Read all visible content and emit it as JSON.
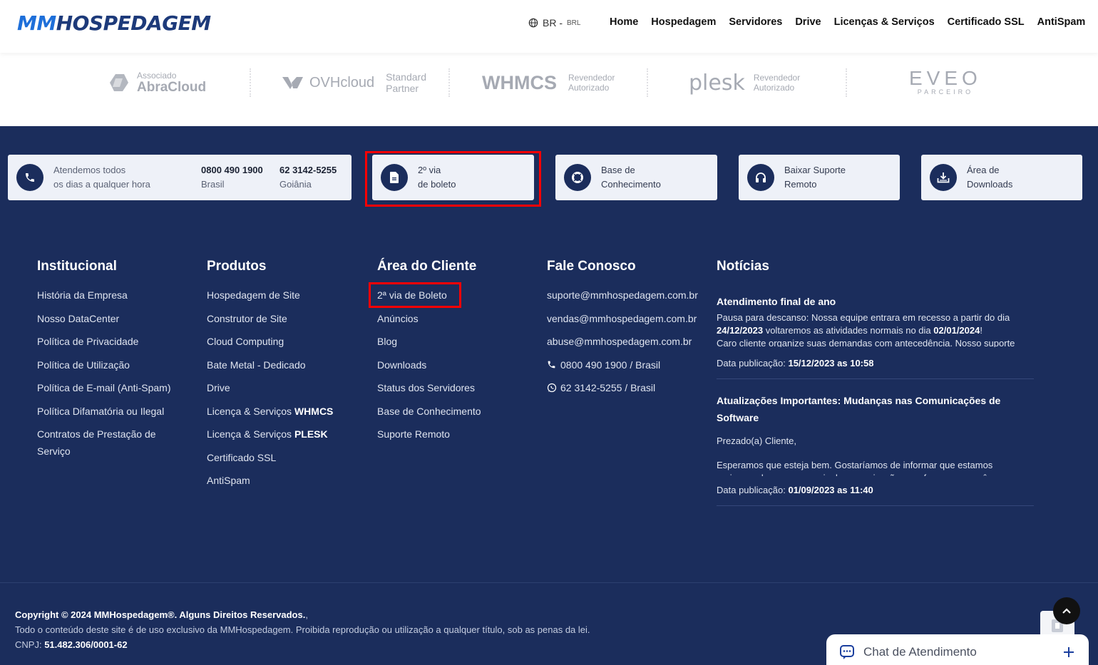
{
  "header": {
    "logo_mm": "MM",
    "logo_rest": "HOSPEDAGEM",
    "lang_main": "BR -",
    "lang_currency": "BRL",
    "nav": [
      "Home",
      "Hospedagem",
      "Servidores",
      "Drive",
      "Licenças & Serviços",
      "Certificado SSL",
      "AntiSpam"
    ]
  },
  "partners": {
    "abracloud_top": "Associado",
    "abracloud_name": "AbraCloud",
    "ovh_name": "OVHcloud",
    "ovh_tier_1": "Standard",
    "ovh_tier_2": "Partner",
    "whmcs_name": "WHMCS",
    "whmcs_sub_1": "Revendedor",
    "whmcs_sub_2": "Autorizado",
    "plesk_name": "plesk",
    "plesk_sub_1": "Revendedor",
    "plesk_sub_2": "Autorizado",
    "eveo_name": "EVEO",
    "eveo_sub": "PARCEIRO"
  },
  "cards": {
    "support_line1": "Atendemos todos",
    "support_line2": "os dias a qualquer hora",
    "phone1_number": "0800 490 1900",
    "phone1_place": "Brasil",
    "phone2_number": "62 3142-5255",
    "phone2_place": "Goiânia",
    "boleto_line1": "2º via",
    "boleto_line2": "de boleto",
    "kb_line1": "Base de",
    "kb_line2": "Conhecimento",
    "remote_line1": "Baixar Suporte",
    "remote_line2": "Remoto",
    "downloads_line1": "Área de",
    "downloads_line2": "Downloads"
  },
  "columns": {
    "institucional": {
      "title": "Institucional",
      "links": [
        "História da Empresa",
        "Nosso DataCenter",
        "Política de Privacidade",
        "Política de Utilização",
        "Política de E-mail (Anti-Spam)",
        "Política Difamatória ou Ilegal",
        "Contratos de Prestação de Serviço"
      ]
    },
    "produtos": {
      "title": "Produtos",
      "links": [
        "Hospedagem de Site",
        "Construtor de Site",
        "Cloud Computing",
        "Bate Metal - Dedicado",
        "Drive"
      ],
      "whmcs_prefix": "Licença & Serviços",
      "whmcs_bold": "WHMCS",
      "plesk_prefix": "Licença & Serviços",
      "plesk_bold": "PLESK",
      "links_after": [
        "Certificado SSL",
        "AntiSpam"
      ]
    },
    "cliente": {
      "title": "Área do Cliente",
      "links": [
        "2ª via de Boleto",
        "Anúncios",
        "Blog",
        "Downloads",
        "Status dos Servidores",
        "Base de Conhecimento",
        "Suporte Remoto"
      ]
    },
    "contato": {
      "title": "Fale Conosco",
      "emails": [
        "suporte@mmhospedagem.com.br",
        "vendas@mmhospedagem.com.br",
        "abuse@mmhospedagem.com.br"
      ],
      "phone": "0800 490 1900 / Brasil",
      "whatsapp": "62 3142-5255 / Brasil"
    }
  },
  "news": {
    "title": "Notícias",
    "item1_title": "Atendimento final de ano",
    "item1_p1": "Pausa para descanso: Nossa equipe entrara em recesso a partir do dia",
    "item1_date_a": "24/12/2023",
    "item1_p2": "voltaremos as atividades normais no dia",
    "item1_date_b": "02/01/2024",
    "item1_p3": "!",
    "item1_p4": "Caro cliente organize suas demandas com antecedência. Nosso suporte técnico apenas resolvera problemas de emergência por ticket de",
    "date_label": "Data publicação:",
    "item1_date": "15/12/2023 as 10:58",
    "item2_title": "Atualizações Importantes: Mudanças nas Comunicações de Software",
    "item2_p1": "Prezado(a) Cliente,",
    "item2_p2": "Esperamos que esteja bem. Gostaríamos de informar que estamos aprimorando nossos canais de comunicação para fornecer a você as",
    "item2_date": "01/09/2023 as 11:40"
  },
  "copyright": {
    "line1_bold": "Copyright © 2024 MMHospedagem®. Alguns Direitos Reservados.",
    "line1_end": ",",
    "line2": "Todo o conteúdo deste site é de uso exclusivo da MMHospedagem. Proibida reprodução ou utilização a qualquer título, sob as penas da lei.",
    "cnpj_label": "CNPJ:",
    "cnpj_value": "51.482.306/0001-62"
  },
  "chat": {
    "label": "Chat de Atendimento"
  },
  "colors": {
    "footer_bg": "#1b2d5c",
    "highlight": "#ff0000",
    "logo_blue": "#1e6fd9"
  }
}
